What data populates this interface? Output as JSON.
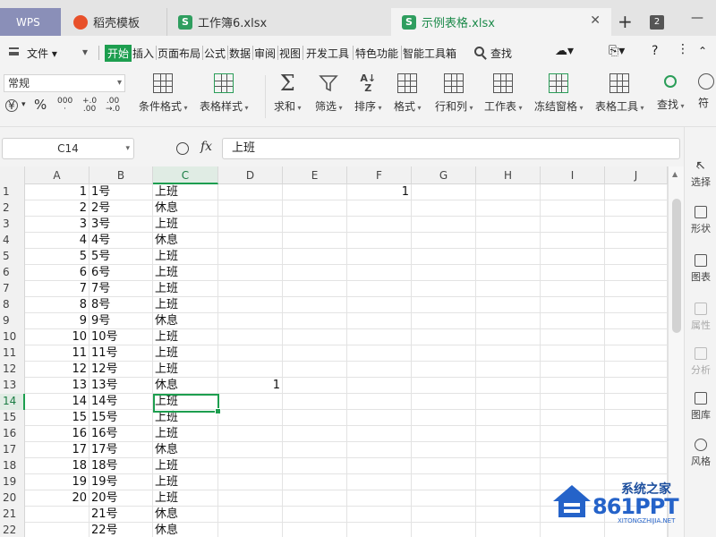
{
  "titlebar": {
    "tabs": [
      {
        "label": "WPS"
      },
      {
        "label": "稻壳模板"
      },
      {
        "label": "工作簿6.xlsx"
      },
      {
        "label": "示例表格.xlsx",
        "active": true
      }
    ],
    "add_label": "+",
    "close_label": "✕",
    "tab_count": "2",
    "minimize_label": "—"
  },
  "menubar": {
    "file_label": "文件",
    "items": [
      "开始",
      "插入",
      "页面布局",
      "公式",
      "数据",
      "审阅",
      "视图",
      "开发工具",
      "特色功能",
      "智能工具箱"
    ],
    "search_label": "查找",
    "help_label": "?"
  },
  "ribbon": {
    "font_select": "常规",
    "numfmt": {
      "percent": "%",
      "thousands": "000",
      "inc_decimal": "+.0\n.00",
      "dec_decimal": ".00\n→.0"
    },
    "buttons": [
      {
        "label": "条件格式",
        "icon": "conditional-format-icon"
      },
      {
        "label": "表格样式",
        "icon": "table-style-icon"
      },
      {
        "label": "求和",
        "icon": "sigma-icon"
      },
      {
        "label": "筛选",
        "icon": "filter-icon"
      },
      {
        "label": "排序",
        "icon": "sort-az-icon"
      },
      {
        "label": "格式",
        "icon": "format-icon"
      },
      {
        "label": "行和列",
        "icon": "rows-cols-icon"
      },
      {
        "label": "工作表",
        "icon": "worksheet-icon"
      },
      {
        "label": "冻结窗格",
        "icon": "freeze-panes-icon"
      },
      {
        "label": "表格工具",
        "icon": "table-tools-icon"
      },
      {
        "label": "查找",
        "icon": "find-icon"
      },
      {
        "label": "符",
        "icon": "symbol-icon"
      }
    ]
  },
  "formulabar": {
    "namebox": "C14",
    "fx_label": "fx",
    "formula": "上班"
  },
  "sheet": {
    "columns": [
      "A",
      "B",
      "C",
      "D",
      "E",
      "F",
      "G",
      "H",
      "I",
      "J"
    ],
    "selected_column": "C",
    "selected_row": "14",
    "rows": [
      {
        "n": "1",
        "A": "1",
        "B": "1号",
        "C": "上班",
        "F": "1"
      },
      {
        "n": "2",
        "A": "2",
        "B": "2号",
        "C": "休息"
      },
      {
        "n": "3",
        "A": "3",
        "B": "3号",
        "C": "上班"
      },
      {
        "n": "4",
        "A": "4",
        "B": "4号",
        "C": "休息"
      },
      {
        "n": "5",
        "A": "5",
        "B": "5号",
        "C": "上班"
      },
      {
        "n": "6",
        "A": "6",
        "B": "6号",
        "C": "上班"
      },
      {
        "n": "7",
        "A": "7",
        "B": "7号",
        "C": "上班"
      },
      {
        "n": "8",
        "A": "8",
        "B": "8号",
        "C": "上班"
      },
      {
        "n": "9",
        "A": "9",
        "B": "9号",
        "C": "休息"
      },
      {
        "n": "10",
        "A": "10",
        "B": "10号",
        "C": "上班"
      },
      {
        "n": "11",
        "A": "11",
        "B": "11号",
        "C": "上班"
      },
      {
        "n": "12",
        "A": "12",
        "B": "12号",
        "C": "上班"
      },
      {
        "n": "13",
        "A": "13",
        "B": "13号",
        "C": "休息",
        "D": "1"
      },
      {
        "n": "14",
        "A": "14",
        "B": "14号",
        "C": "上班"
      },
      {
        "n": "15",
        "A": "15",
        "B": "15号",
        "C": "上班"
      },
      {
        "n": "16",
        "A": "16",
        "B": "16号",
        "C": "上班"
      },
      {
        "n": "17",
        "A": "17",
        "B": "17号",
        "C": "休息"
      },
      {
        "n": "18",
        "A": "18",
        "B": "18号",
        "C": "上班"
      },
      {
        "n": "19",
        "A": "19",
        "B": "19号",
        "C": "上班"
      },
      {
        "n": "20",
        "A": "20",
        "B": "20号",
        "C": "上班"
      },
      {
        "n": "21",
        "A": "",
        "B": "21号",
        "C": "休息"
      },
      {
        "n": "22",
        "A": "",
        "B": "22号",
        "C": "休息"
      }
    ]
  },
  "sidepanel": {
    "items": [
      {
        "label": "选择",
        "icon": "select-icon"
      },
      {
        "label": "形状",
        "icon": "shape-icon"
      },
      {
        "label": "图表",
        "icon": "chart-icon"
      },
      {
        "label": "属性",
        "icon": "properties-icon",
        "dim": true
      },
      {
        "label": "分析",
        "icon": "analysis-icon",
        "dim": true
      },
      {
        "label": "图库",
        "icon": "gallery-icon"
      },
      {
        "label": "风格",
        "icon": "style-icon"
      }
    ]
  },
  "watermark": {
    "brand": "系统之家",
    "site": "861PPT",
    "url": "XITONGZHIJIA.NET"
  },
  "colors": {
    "accent": "#1d9e4f",
    "tab_wps": "#8a8fb8",
    "watermark": "#2563c9"
  }
}
